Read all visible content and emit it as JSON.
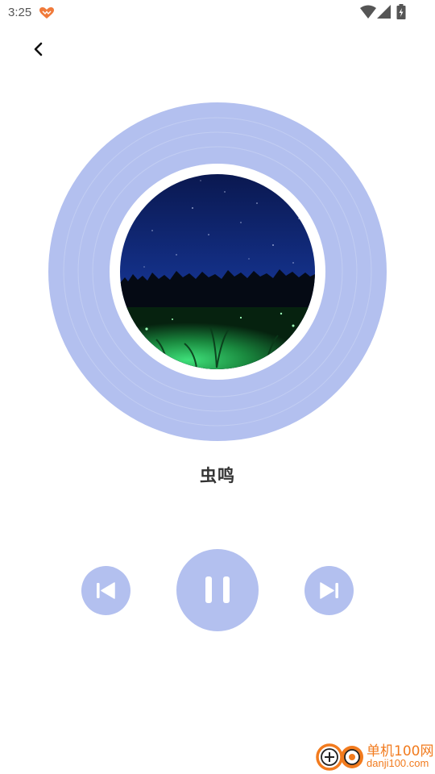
{
  "status_bar": {
    "time": "3:25",
    "notification_icon": "heart-notification-icon",
    "wifi_icon": "wifi-icon",
    "signal_icon": "cell-signal-icon",
    "battery_icon": "battery-charging-icon"
  },
  "header": {
    "back_icon": "chevron-left-icon"
  },
  "player": {
    "title": "虫鸣",
    "cover_art": "night-sky-forest-fireflies",
    "disc_color": "#b3c0ef",
    "state": "playing"
  },
  "controls": {
    "previous_icon": "skip-previous-icon",
    "play_pause_icon": "pause-icon",
    "next_icon": "skip-next-icon",
    "button_color": "#b3c0ef"
  },
  "watermark": {
    "name": "单机100网",
    "domain": "danji100.com",
    "color": "#f27b1e"
  }
}
